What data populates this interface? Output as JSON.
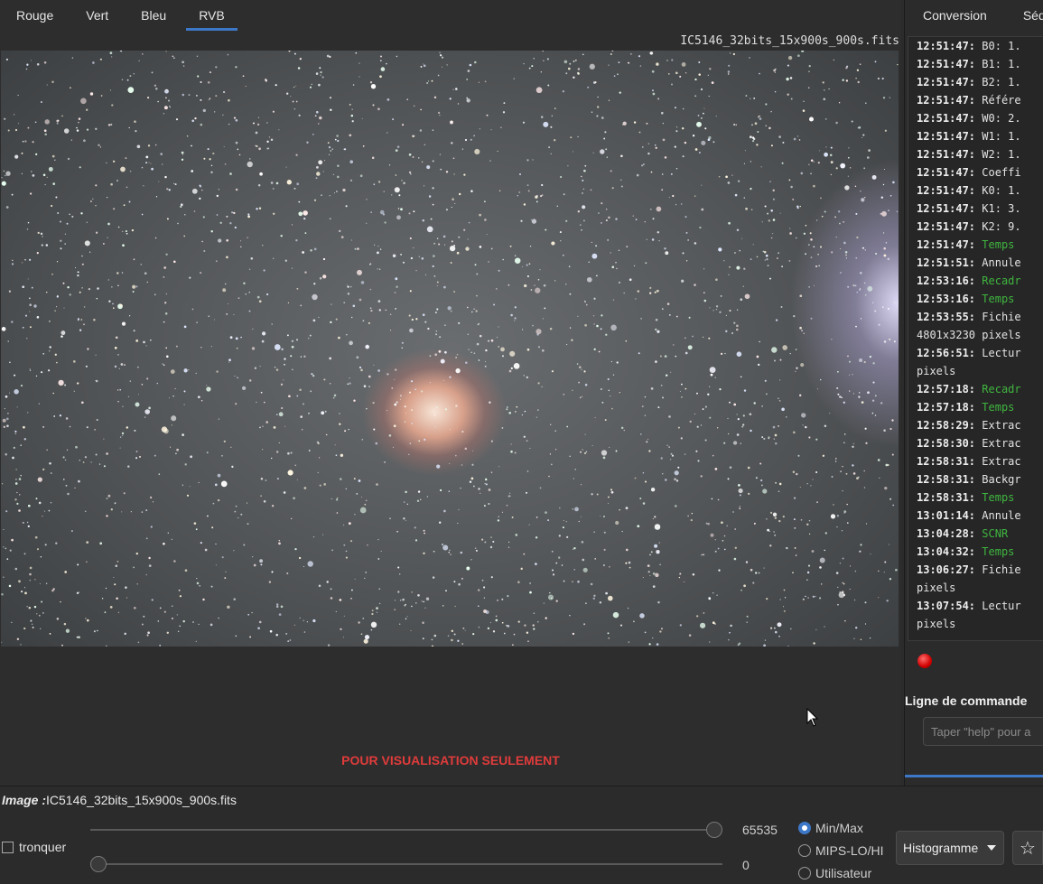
{
  "viewer": {
    "tabs": [
      "Rouge",
      "Vert",
      "Bleu",
      "RVB"
    ],
    "active_tab": "RVB",
    "filename": "IC5146_32bits_15x900s_900s.fits",
    "watermark": "POUR VISUALISATION SEULEMENT"
  },
  "right_panel": {
    "tabs": [
      "Conversion",
      "Séquence"
    ],
    "log": [
      {
        "ts": "12:51:47:",
        "text": "B0: 1.",
        "green": false
      },
      {
        "ts": "12:51:47:",
        "text": "B1: 1.",
        "green": false
      },
      {
        "ts": "12:51:47:",
        "text": "B2: 1.",
        "green": false
      },
      {
        "ts": "12:51:47:",
        "text": "Référe",
        "green": false
      },
      {
        "ts": "12:51:47:",
        "text": "W0: 2.",
        "green": false
      },
      {
        "ts": "12:51:47:",
        "text": "W1: 1.",
        "green": false
      },
      {
        "ts": "12:51:47:",
        "text": "W2: 1.",
        "green": false
      },
      {
        "ts": "12:51:47:",
        "text": "Coeffi",
        "green": false
      },
      {
        "ts": "12:51:47:",
        "text": "K0: 1.",
        "green": false
      },
      {
        "ts": "12:51:47:",
        "text": "K1: 3.",
        "green": false
      },
      {
        "ts": "12:51:47:",
        "text": "K2: 9.",
        "green": false
      },
      {
        "ts": "12:51:47:",
        "text": "Temps",
        "green": true
      },
      {
        "ts": "12:51:51:",
        "text": "Annule",
        "green": false
      },
      {
        "ts": "12:53:16:",
        "text": "Recadr",
        "green": true
      },
      {
        "ts": "12:53:16:",
        "text": "Temps",
        "green": true
      },
      {
        "ts": "12:53:55:",
        "text": "Fichie",
        "green": false,
        "cont": "4801x3230 pixels"
      },
      {
        "ts": "12:56:51:",
        "text": "Lectur",
        "green": false,
        "cont": "pixels"
      },
      {
        "ts": "12:57:18:",
        "text": "Recadr",
        "green": true
      },
      {
        "ts": "12:57:18:",
        "text": "Temps",
        "green": true
      },
      {
        "ts": "12:58:29:",
        "text": "Extrac",
        "green": false
      },
      {
        "ts": "12:58:30:",
        "text": "Extrac",
        "green": false
      },
      {
        "ts": "12:58:31:",
        "text": "Extrac",
        "green": false
      },
      {
        "ts": "12:58:31:",
        "text": "Backgr",
        "green": false
      },
      {
        "ts": "12:58:31:",
        "text": "Temps",
        "green": true
      },
      {
        "ts": "13:01:14:",
        "text": "Annule",
        "green": false
      },
      {
        "ts": "13:04:28:",
        "text": "SCNR",
        "green": true
      },
      {
        "ts": "13:04:32:",
        "text": "Temps",
        "green": true
      },
      {
        "ts": "13:06:27:",
        "text": "Fichie",
        "green": false,
        "cont": "pixels"
      },
      {
        "ts": "13:07:54:",
        "text": "Lectur",
        "green": false,
        "cont": "pixels"
      }
    ],
    "command_label": "Ligne de commande",
    "command_placeholder": "Taper \"help\" pour a"
  },
  "bottom": {
    "image_label": "Image :",
    "image_name": "IC5146_32bits_15x900s_900s.fits",
    "tronquer_label": "tronquer",
    "slider_high_value": "65535",
    "slider_low_value": "0",
    "slider_high_fraction": 1.0,
    "slider_low_fraction": 0.0,
    "radio_options": [
      "Min/Max",
      "MIPS-LO/HI",
      "Utilisateur"
    ],
    "radio_selected": "Min/Max",
    "display_mode": "Histogramme"
  }
}
